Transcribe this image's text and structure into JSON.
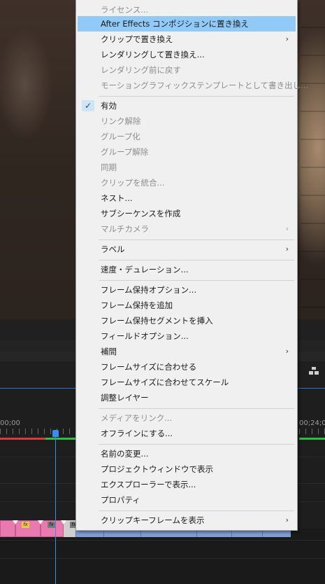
{
  "context_menu": {
    "items": [
      {
        "label": "ライセンス...",
        "disabled": true
      },
      {
        "label": "After Effects コンポジションに置き換え",
        "highlighted": true
      },
      {
        "label": "クリップで置き換え",
        "submenu": true
      },
      {
        "label": "レンダリングして置き換え..."
      },
      {
        "label": "レンダリング前に戻す",
        "disabled": true
      },
      {
        "label": "モーショングラフィックステンプレートとして書き出し...",
        "disabled": true
      },
      {
        "label": "有効",
        "checked": true
      },
      {
        "label": "リンク解除",
        "disabled": true
      },
      {
        "label": "グループ化",
        "disabled": true
      },
      {
        "label": "グループ解除",
        "disabled": true
      },
      {
        "label": "同期",
        "disabled": true
      },
      {
        "label": "クリップを統合...",
        "disabled": true
      },
      {
        "label": "ネスト..."
      },
      {
        "label": "サブシーケンスを作成"
      },
      {
        "label": "マルチカメラ",
        "disabled": true,
        "submenu": true
      },
      {
        "label": "ラベル",
        "submenu": true
      },
      {
        "label": "速度・デュレーション..."
      },
      {
        "label": "フレーム保持オプション..."
      },
      {
        "label": "フレーム保持を追加"
      },
      {
        "label": "フレーム保持セグメントを挿入"
      },
      {
        "label": "フィールドオプション..."
      },
      {
        "label": "補間",
        "submenu": true
      },
      {
        "label": "フレームサイズに合わせる"
      },
      {
        "label": "フレームサイズに合わせてスケール"
      },
      {
        "label": "調整レイヤー"
      },
      {
        "label": "メディアをリンク...",
        "disabled": true
      },
      {
        "label": "オフラインにする..."
      },
      {
        "label": "名前の変更..."
      },
      {
        "label": "プロジェクトウィンドウで表示"
      },
      {
        "label": "エクスプローラーで表示..."
      },
      {
        "label": "プロパティ"
      },
      {
        "label": "クリップキーフレームを表示",
        "submenu": true
      }
    ],
    "check_glyph": "✓",
    "submenu_glyph": "›"
  },
  "timeline": {
    "timecode_left": "00;00",
    "timecode_right": "00;24;0",
    "fx_badge": "fx"
  },
  "colors": {
    "highlight": "#91c9f7",
    "playhead": "#3d8bf0",
    "clip_pink": "#e87ab0",
    "clip_blue": "#7f9ed6"
  }
}
